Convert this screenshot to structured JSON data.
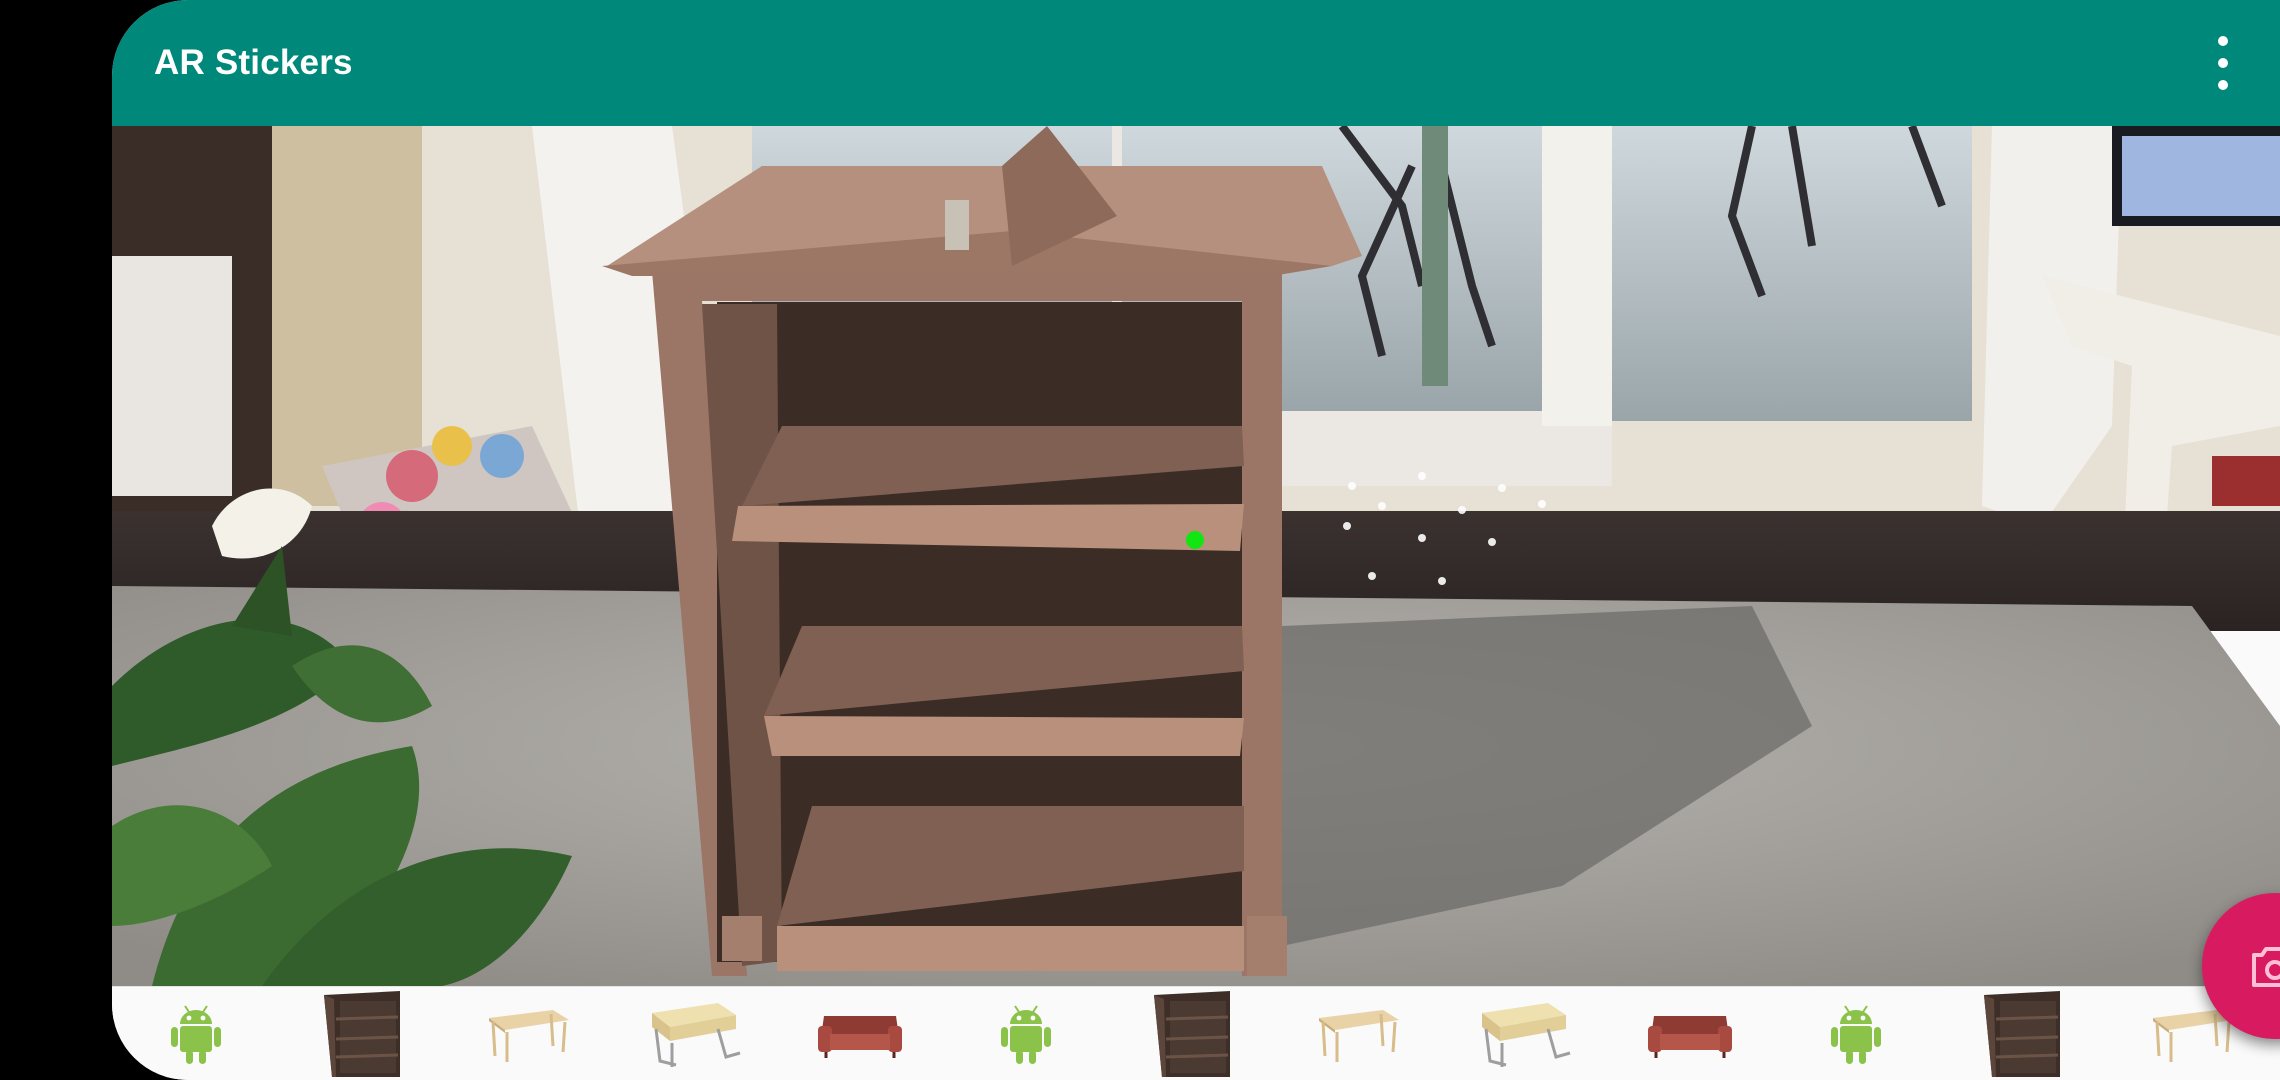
{
  "app": {
    "title": "AR Stickers",
    "menu_icon": "more-vert-icon"
  },
  "camera_view": {
    "placed_model": "bookshelf",
    "tracking_marker_color": "#12e612"
  },
  "model_tray": {
    "items": [
      {
        "model": "android"
      },
      {
        "model": "bookshelf"
      },
      {
        "model": "table"
      },
      {
        "model": "desk"
      },
      {
        "model": "sofa"
      },
      {
        "model": "android"
      },
      {
        "model": "bookshelf"
      },
      {
        "model": "table"
      },
      {
        "model": "desk"
      },
      {
        "model": "sofa"
      },
      {
        "model": "android"
      },
      {
        "model": "bookshelf"
      },
      {
        "model": "table"
      }
    ]
  },
  "capture_button": {
    "icon": "camera-icon",
    "color": "#d81b60"
  },
  "colors": {
    "app_bar": "#00897b",
    "tray_background": "#fafafa"
  }
}
